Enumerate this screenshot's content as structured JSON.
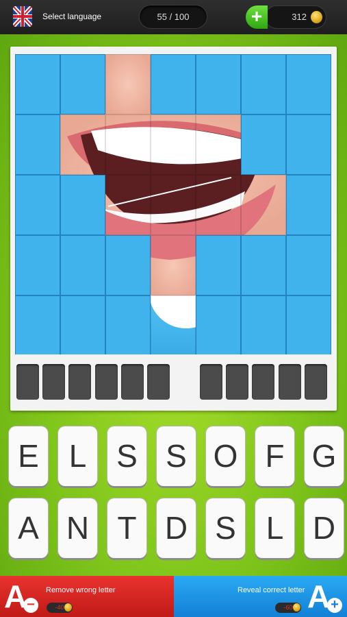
{
  "header": {
    "language_label": "Select language",
    "progress": "55 / 100",
    "coins": "312",
    "add_symbol": "+"
  },
  "puzzle": {
    "answer_slots_word1": 6,
    "answer_slots_word2": 5
  },
  "keyboard": {
    "row1": [
      "E",
      "L",
      "S",
      "S",
      "O",
      "F",
      "G"
    ],
    "row2": [
      "A",
      "N",
      "T",
      "D",
      "S",
      "L",
      "D"
    ]
  },
  "hints": {
    "remove": {
      "label": "Remove wrong letter",
      "cost": "-40",
      "icon": "A"
    },
    "reveal": {
      "label": "Reveal correct letter",
      "cost": "-60",
      "icon": "A"
    }
  },
  "colors": {
    "background_green": "#7fc51b",
    "remove_red": "#e9332f",
    "reveal_blue": "#2aa9f3"
  }
}
